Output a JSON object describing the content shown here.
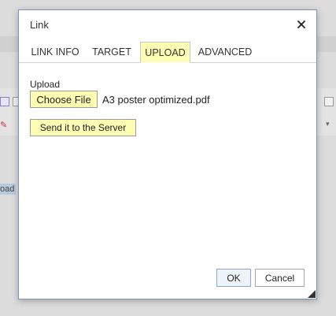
{
  "dialog": {
    "title": "Link",
    "close_icon": "close-icon"
  },
  "tabs": [
    {
      "label": "LINK INFO",
      "active": false
    },
    {
      "label": "TARGET",
      "active": false
    },
    {
      "label": "UPLOAD",
      "active": true
    },
    {
      "label": "ADVANCED",
      "active": false
    }
  ],
  "upload": {
    "label": "Upload",
    "choose_file_label": "Choose File",
    "file_name": "A3 poster optimized.pdf",
    "send_label": "Send it to the Server"
  },
  "footer": {
    "ok_label": "OK",
    "cancel_label": "Cancel"
  },
  "background": {
    "partial_text": "oad"
  },
  "colors": {
    "highlight": "#fdfdb4",
    "dialog_border": "#7a96c4"
  }
}
